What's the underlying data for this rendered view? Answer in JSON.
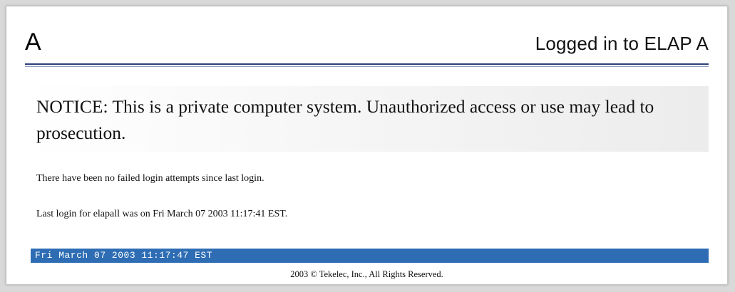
{
  "header": {
    "system_letter": "A",
    "logged_in_text": "Logged in to ELAP A"
  },
  "notice": {
    "text": "NOTICE: This is a private computer system. Unauthorized access or use may lead to prosecution."
  },
  "messages": {
    "failed_logins": "There have been no failed login attempts since last login.",
    "last_login": "Last login for elapall was on Fri March 07 2003 11:17:41 EST."
  },
  "status_bar": {
    "datetime": "Fri March 07 2003 11:17:47 EST"
  },
  "footer": {
    "copyright": "2003 © Tekelec, Inc., All Rights Reserved."
  },
  "colors": {
    "status_bar_bg": "#2e6db4",
    "header_rule": "#2b3f7a"
  }
}
